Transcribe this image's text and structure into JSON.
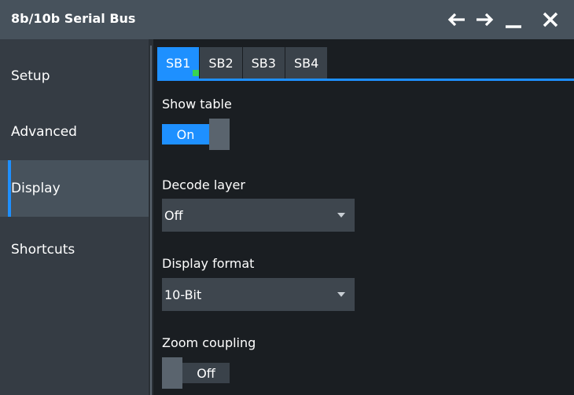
{
  "window": {
    "title": "8b/10b Serial Bus",
    "buttons": [
      "back-arrow",
      "forward-arrow",
      "minimize",
      "close"
    ]
  },
  "sidebar": {
    "items": [
      {
        "label": "Setup",
        "active": false
      },
      {
        "label": "Advanced",
        "active": false
      },
      {
        "label": "Display",
        "active": true
      },
      {
        "label": "Shortcuts",
        "active": false
      }
    ]
  },
  "tabs": [
    {
      "label": "SB1",
      "active": true,
      "indicator": "green"
    },
    {
      "label": "SB2",
      "active": false
    },
    {
      "label": "SB3",
      "active": false
    },
    {
      "label": "SB4",
      "active": false
    }
  ],
  "settings": {
    "show_table": {
      "label": "Show table",
      "value": "On"
    },
    "decode_layer": {
      "label": "Decode layer",
      "value": "Off"
    },
    "display_format": {
      "label": "Display format",
      "value": "10-Bit"
    },
    "zoom_coupling": {
      "label": "Zoom coupling",
      "value": "Off"
    }
  },
  "colors": {
    "accent": "#1e90ff",
    "indicator": "#39d353",
    "titlebar": "#47525c",
    "sidebar": "#353c44",
    "background": "#1a1e22"
  }
}
